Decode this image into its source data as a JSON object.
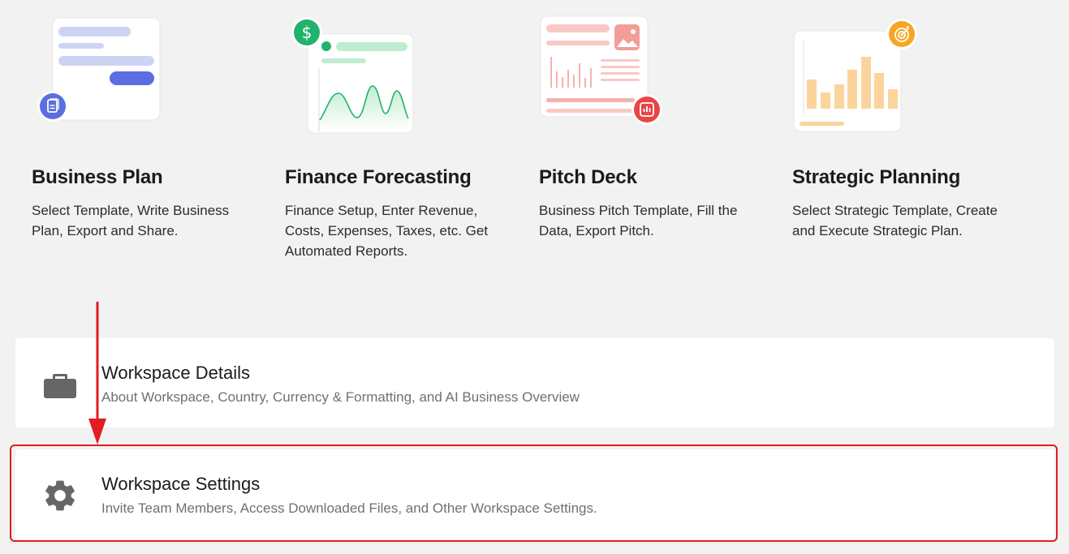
{
  "tiles": [
    {
      "title": "Business Plan",
      "description": "Select Template, Write Business Plan, Export and Share."
    },
    {
      "title": "Finance Forecasting",
      "description": "Finance Setup, Enter Revenue, Costs, Expenses, Taxes, etc. Get Automated Reports."
    },
    {
      "title": "Pitch Deck",
      "description": "Business Pitch Template, Fill the Data, Export Pitch."
    },
    {
      "title": "Strategic Planning",
      "description": "Select Strategic Template, Create and Execute Strategic Plan."
    }
  ],
  "rows": {
    "details": {
      "title": "Workspace Details",
      "subtitle": "About Workspace, Country, Currency & Formatting, and AI Business Overview",
      "icon": "briefcase-icon"
    },
    "settings": {
      "title": "Workspace Settings",
      "subtitle": "Invite Team Members, Access Downloaded Files, and Other Workspace Settings.",
      "icon": "gear-icon"
    }
  },
  "colors": {
    "background": "#f1f2f1",
    "business_plan_accent": "#5b6ee1",
    "finance_accent": "#21b26b",
    "pitch_accent": "#e84545",
    "strategic_accent": "#f5a623",
    "highlight": "#e31b23"
  }
}
